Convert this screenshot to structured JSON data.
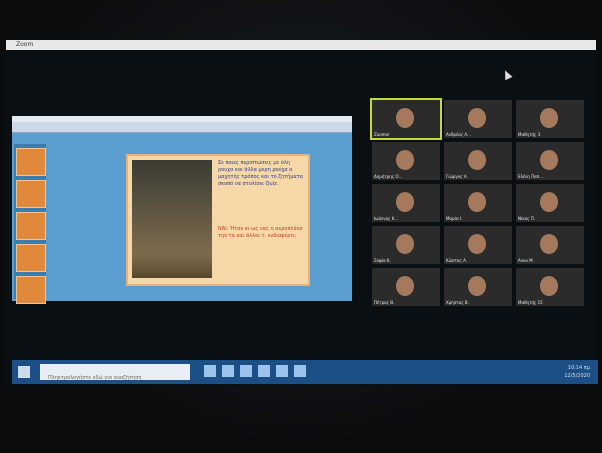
{
  "window": {
    "title": "Zoom"
  },
  "slide": {
    "text_main": "Σε ποιες περιπτώσεις με όλη ρουχα και άλλα μερη ρούχα ο μαχητής τρόπος και το ζητήματα σκοπό να στολίσει Quiz.",
    "text_secondary": "ΝΑΙ: Ήταν κι ως νας η αεροπλάνο την τα και άλλοι τ. ενδιαφέρει;"
  },
  "participants": [
    {
      "name": "Zoomer"
    },
    {
      "name": "Ανδρέας Α..."
    },
    {
      "name": "Μαθητής 3"
    },
    {
      "name": "Δημήτρης Ο..."
    },
    {
      "name": "Γιώργος Α."
    },
    {
      "name": "Ελένη Παπ..."
    },
    {
      "name": "Ιωάννης Κ..."
    },
    {
      "name": "Μαρία Ι."
    },
    {
      "name": "Νίκος Π."
    },
    {
      "name": "Σοφία Κ."
    },
    {
      "name": "Κώστας Α."
    },
    {
      "name": "Αννα Μ."
    },
    {
      "name": "Πέτρος Θ."
    },
    {
      "name": "Χρήστος Β."
    },
    {
      "name": "Μαθητής 15"
    }
  ],
  "taskbar": {
    "search_placeholder": "Πληκτρολογήστε εδώ για αναζήτηση",
    "time": "10:14 πμ",
    "date": "12/5/2020"
  }
}
